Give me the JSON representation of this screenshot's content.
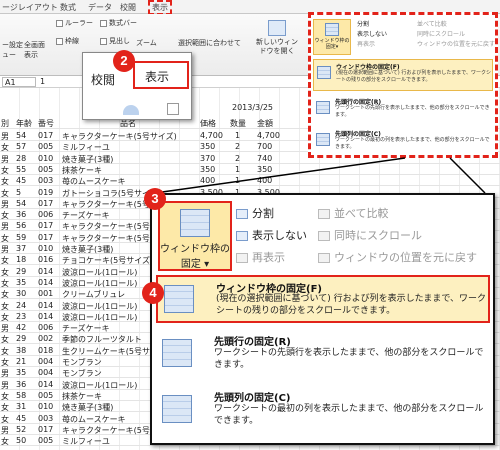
{
  "ribbon": {
    "tabs": [
      "ージレイアウト",
      "数式",
      "データ",
      "校閲",
      "表示"
    ],
    "row1": [
      "ルーラー",
      "数式バー",
      "ズーム",
      "選択範囲に合わせて"
    ],
    "row2": [
      "枠線",
      "見出し"
    ],
    "left_buttons": [
      "ー設定",
      "全画面"
    ],
    "left_buttons2": [
      "ュー",
      "表示"
    ],
    "new_window": "新しいウィンドウを開く",
    "name_box": "A1",
    "fx": "1"
  },
  "mini_popup": {
    "split": "分割",
    "hide": "表示しない",
    "show": "再表示",
    "side": "並べて比較",
    "sync": "同時にスクロール",
    "reset": "ウィンドウの位置を元に戻す",
    "freeze_label": "ウィンドウ枠の固定▾",
    "e1_title": "ウィンドウ枠の固定(F)",
    "e1_desc": "(現在の選択範囲に基づいて) 行および列を表示したままで、ワークシートの残りの部分をスクロールできます。",
    "e2_title": "先頭行の固定(R)",
    "e2_desc": "ワークシートの先頭行を表示したままで、他の部分をスクロールできます。",
    "e3_title": "先頭列の固定(C)",
    "e3_desc": "ワークシートの最初の列を表示したままで、他の部分をスクロールできます。"
  },
  "callout2": {
    "tab_review": "校閲",
    "tab_view": "表示"
  },
  "sheet": {
    "date": "2013/3/25",
    "headers": [
      "別",
      "年齢",
      "番号",
      "品名",
      "価格",
      "数量",
      "金額"
    ],
    "rows": [
      [
        "男",
        "54",
        "017",
        "キャラクターケーキ(5号サイズ)",
        "4,700",
        "1",
        "4,700"
      ],
      [
        "女",
        "57",
        "005",
        "ミルフィーユ",
        "350",
        "2",
        "700"
      ],
      [
        "男",
        "28",
        "010",
        "焼き菓子(3種)",
        "370",
        "2",
        "740"
      ],
      [
        "女",
        "55",
        "005",
        "抹茶ケーキ",
        "350",
        "1",
        "350"
      ],
      [
        "女",
        "45",
        "003",
        "苺のムースケーキ",
        "400",
        "1",
        "400"
      ],
      [
        "女",
        "5",
        "019",
        "ガトーショコラ(5号サイズ)",
        "3,500",
        "1",
        "3,500"
      ],
      [
        "男",
        "54",
        "017",
        "キャラクターケーキ(5号サイズ)",
        "4,700",
        "1",
        "4,700"
      ],
      [
        "女",
        "36",
        "006",
        "チーズケーキ",
        "",
        "",
        ""
      ],
      [
        "男",
        "56",
        "017",
        "キャラクターケーキ(5号サイズ)",
        "",
        "",
        ""
      ],
      [
        "女",
        "59",
        "017",
        "キャラクターケーキ(5号サイズ)",
        "",
        "",
        ""
      ],
      [
        "男",
        "37",
        "010",
        "焼き菓子(3種)",
        "",
        "",
        ""
      ],
      [
        "女",
        "18",
        "016",
        "チョコケーキ(5号サイズ)",
        "",
        "",
        ""
      ],
      [
        "女",
        "29",
        "014",
        "波涼ロール(1ロール)",
        "",
        "",
        ""
      ],
      [
        "女",
        "35",
        "014",
        "波涼ロール(1ロール)",
        "",
        "",
        ""
      ],
      [
        "女",
        "30",
        "001",
        "クリームブリュレ",
        "",
        "",
        ""
      ],
      [
        "女",
        "24",
        "014",
        "波涼ロール(1ロール)",
        "",
        "",
        ""
      ],
      [
        "女",
        "23",
        "014",
        "波涼ロール(1ロール)",
        "",
        "",
        ""
      ],
      [
        "男",
        "42",
        "006",
        "チーズケーキ",
        "",
        "",
        ""
      ],
      [
        "女",
        "29",
        "002",
        "季節のフルーツタルト",
        "",
        "",
        ""
      ],
      [
        "女",
        "38",
        "018",
        "生クリームケーキ(5号サイ",
        "",
        "",
        ""
      ],
      [
        "女",
        "21",
        "004",
        "モンブラン",
        "",
        "",
        ""
      ],
      [
        "男",
        "35",
        "004",
        "モンブラン",
        "",
        "",
        ""
      ],
      [
        "男",
        "36",
        "014",
        "波涼ロール(1ロール)",
        "",
        "",
        ""
      ],
      [
        "女",
        "58",
        "005",
        "抹茶ケーキ",
        "",
        "",
        ""
      ],
      [
        "女",
        "31",
        "010",
        "焼き菓子(3種)",
        "",
        "",
        ""
      ],
      [
        "女",
        "45",
        "003",
        "苺のムースケーキ",
        "",
        "",
        ""
      ],
      [
        "男",
        "52",
        "017",
        "キャラクターケーキ(5号サイズ)",
        "",
        "",
        ""
      ],
      [
        "女",
        "50",
        "005",
        "ミルフィーユ",
        "",
        "",
        ""
      ]
    ]
  },
  "menu": {
    "freeze_btn_line1": "ウィンドウ枠の",
    "freeze_btn_line2": "固定",
    "split": "分割",
    "hide": "表示しない",
    "show": "再表示",
    "side_by_side": "並べて比較",
    "sync_scroll": "同時にスクロール",
    "reset_pos": "ウィンドウの位置を元に戻す",
    "entry1_title": "ウィンドウ枠の固定(F)",
    "entry1_desc": "(現在の選択範囲に基づいて) 行および列を表示したままで、ワークシートの残りの部分をスクロールできます。",
    "entry2_title": "先頭行の固定(R)",
    "entry2_desc": "ワークシートの先頭行を表示したままで、他の部分をスクロールできます。",
    "entry3_title": "先頭列の固定(C)",
    "entry3_desc": "ワークシートの最初の列を表示したままで、他の部分をスクロールできます。"
  },
  "badges": [
    "2",
    "3",
    "4"
  ],
  "colors": {
    "accent_red": "#e2231a",
    "highlight": "#fdf0c0",
    "highlight_border": "#e9b84a"
  }
}
